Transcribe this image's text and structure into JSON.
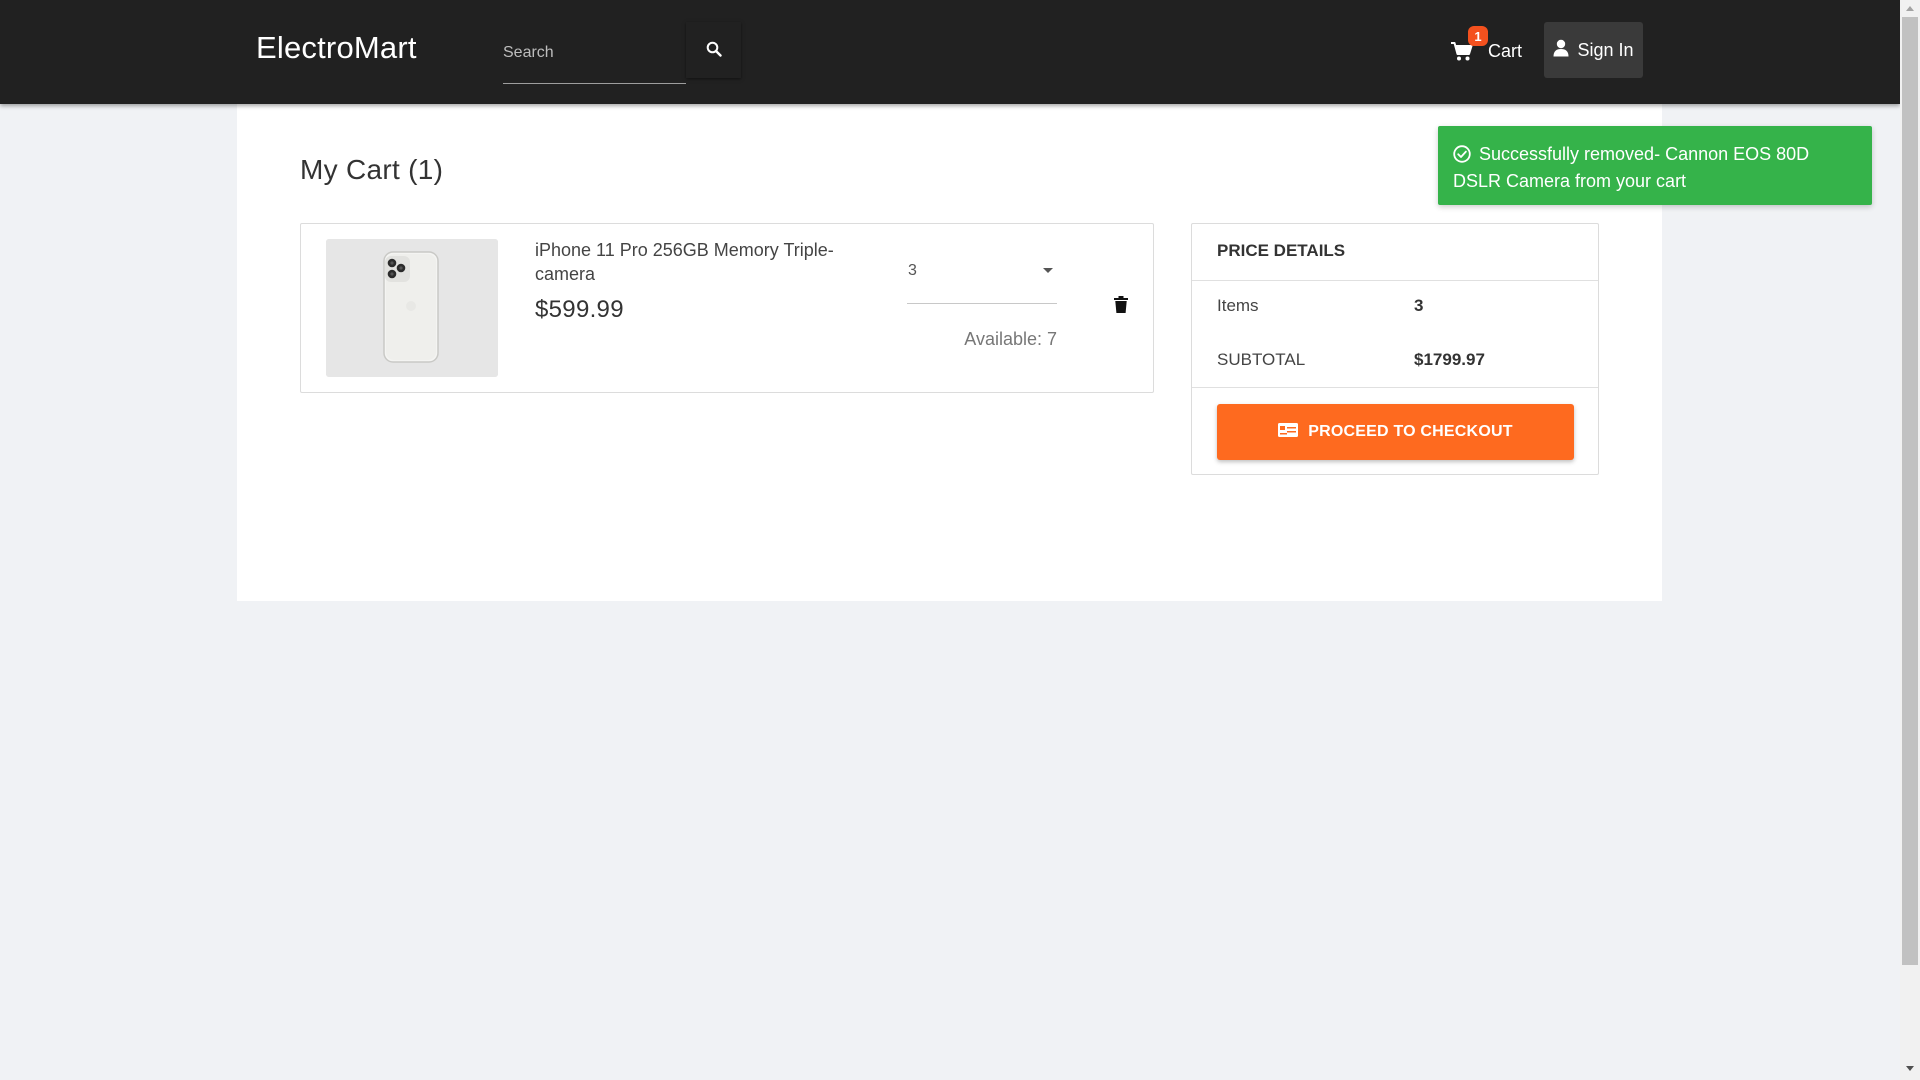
{
  "header": {
    "brand": "ElectroMart",
    "search": {
      "placeholder": "Search",
      "value": ""
    },
    "cart": {
      "label": "Cart",
      "badge_count": "1"
    },
    "signin": {
      "label": "Sign In"
    }
  },
  "cart_page": {
    "title": "My Cart (1)",
    "items": [
      {
        "name": "iPhone 11 Pro 256GB Memory Triple-camera",
        "price": "$599.99",
        "quantity": "3",
        "available": "Available: 7"
      }
    ]
  },
  "price_details": {
    "title": "PRICE DETAILS",
    "items_label": "Items",
    "items_value": "3",
    "subtotal_label": "SUBTOTAL",
    "subtotal_value": "$1799.97",
    "checkout_label": "PROCEED TO CHECKOUT"
  },
  "toast": {
    "message": "Successfully removed- Cannon EOS 80D DSLR Camera from your cart"
  },
  "colors": {
    "navbar": "#212121",
    "accent_orange": "#fe6a1f",
    "badge": "#f4511e",
    "toast_green": "#35b34a",
    "page_bg": "#f0f2f5"
  },
  "icons": {
    "search": "search-icon",
    "cart": "shopping-cart-icon",
    "user": "user-icon",
    "trash": "trash-icon",
    "checkout": "credit-card-icon",
    "toast": "check-circle-icon"
  }
}
